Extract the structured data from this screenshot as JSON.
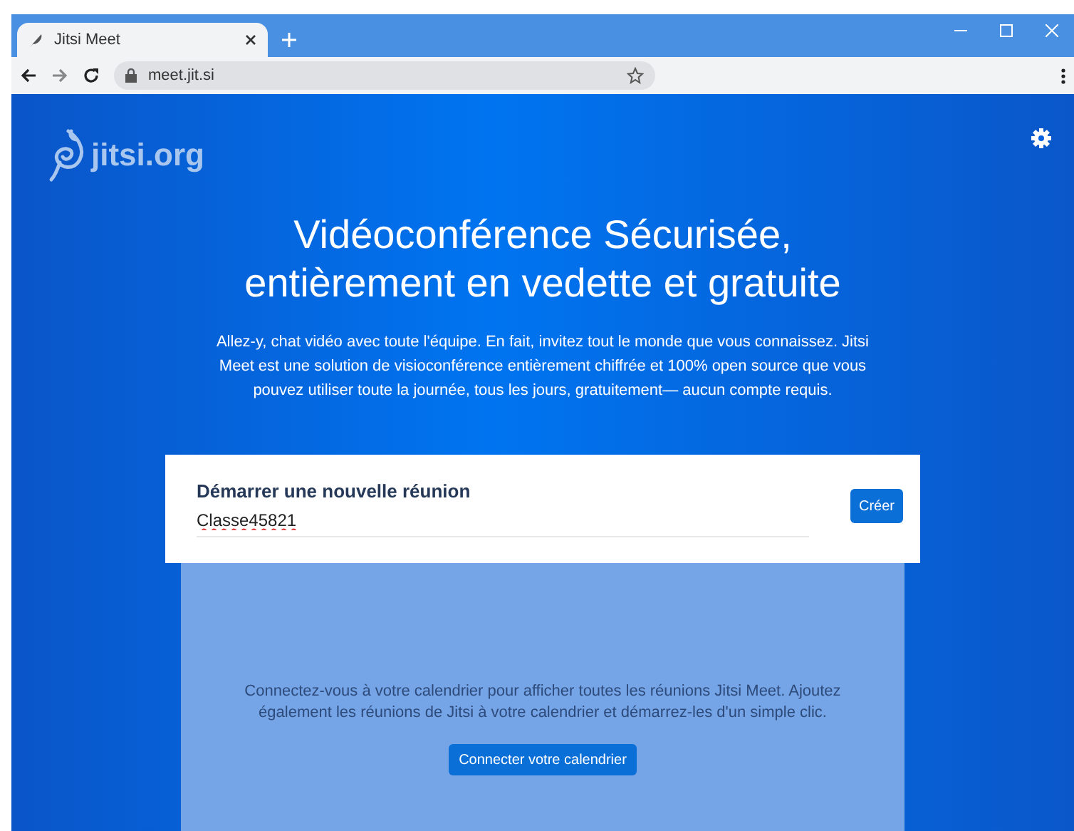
{
  "browser": {
    "tab": {
      "title": "Jitsi Meet",
      "selected": true
    },
    "address": "meet.jit.si"
  },
  "page": {
    "logo": "jitsi.org",
    "heading": "Vidéoconférence Sécurisée, entièrement en vedette et gratuite",
    "intro": "Allez-y, chat vidéo avec toute l'équipe. En fait, invitez tout le monde que vous connaissez. Jitsi Meet est une solution de visioconférence entièrement chiffrée et 100% open source que vous pouvez utiliser toute la journée, tous les jours, gratuitement— aucun compte requis.",
    "meeting": {
      "title": "Démarrer une nouvelle réunion",
      "value": "Classe45821",
      "button": "Créer"
    },
    "calendar": {
      "text": "Connectez-vous à votre calendrier pour afficher toutes les réunions Jitsi Meet. Ajoutez également les réunions de Jitsi à votre calendrier et démarrez-les d'un simple clic.",
      "button": "Connecter votre calendrier"
    }
  }
}
